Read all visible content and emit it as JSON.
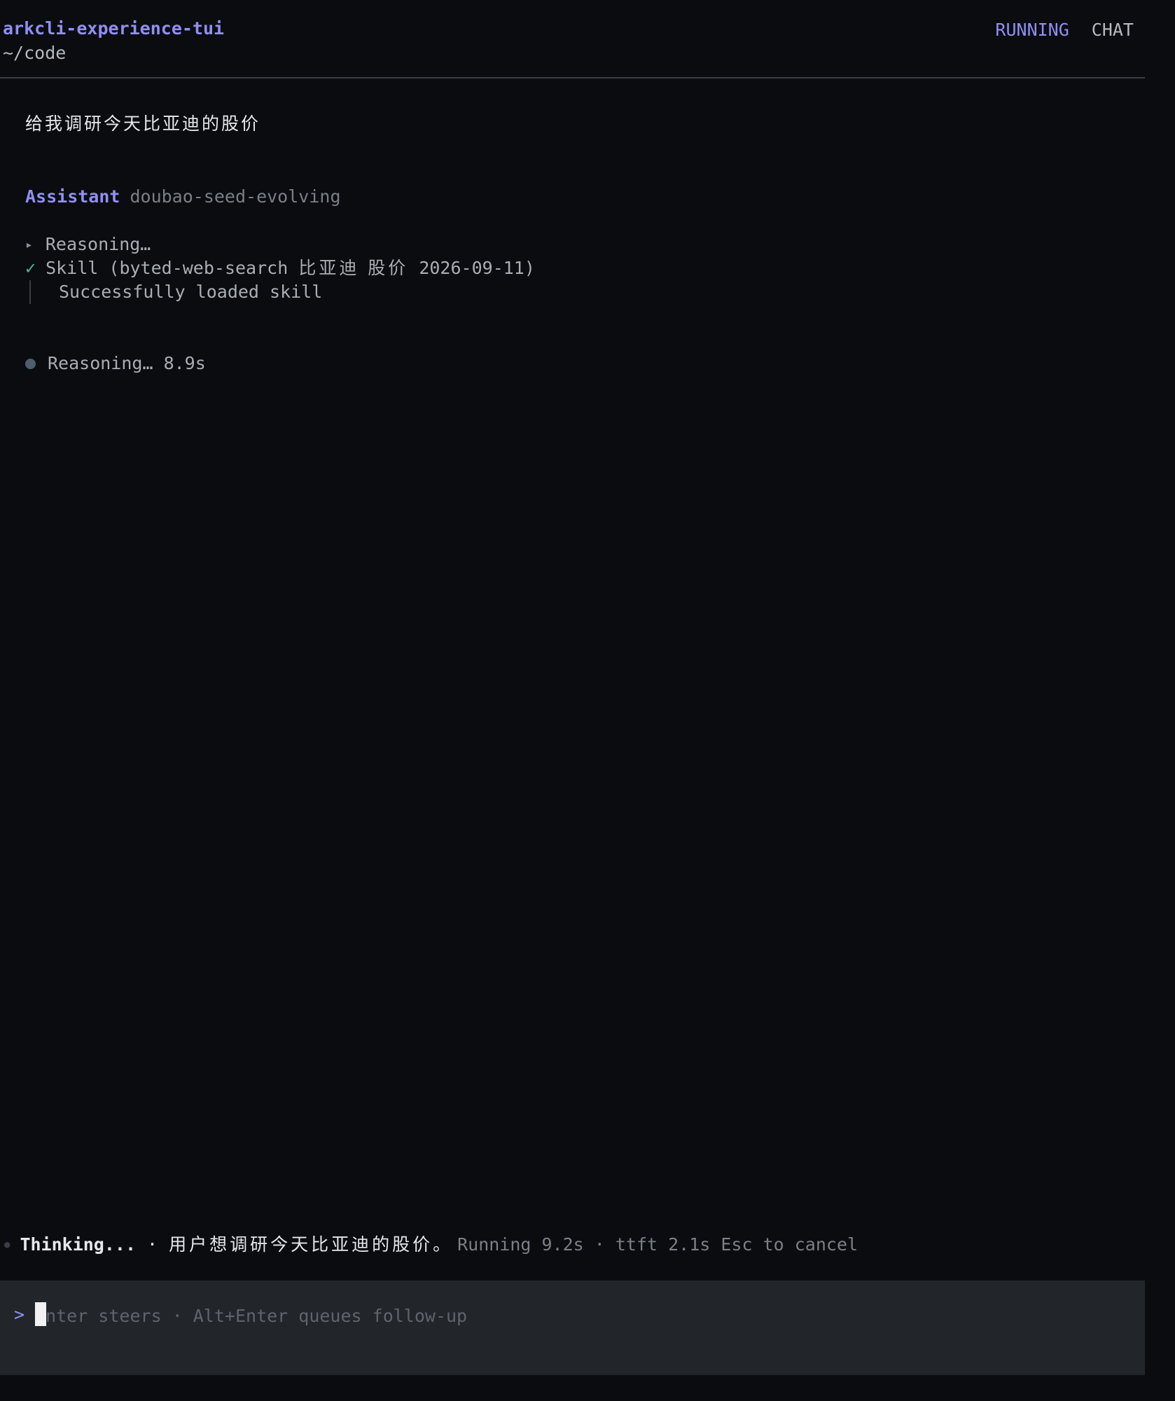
{
  "header": {
    "app_title": "arkcli-experience-tui",
    "cwd": "~/code",
    "status": "RUNNING",
    "mode": "CHAT"
  },
  "conversation": {
    "user_message": "给我调研今天比亚迪的股价",
    "assistant_label": "Assistant",
    "model_name": "doubao-seed-evolving",
    "reasoning_collapsed": "Reasoning…",
    "skill": {
      "name": "Skill",
      "args_prefix": "(byted-web-search ",
      "args_cjk": "比亚迪 股价",
      "args_suffix": " 2026-09-11)",
      "detail": "Successfully loaded skill"
    },
    "reasoning_live": "Reasoning… 8.9s"
  },
  "status_bar": {
    "thinking_label": "Thinking...",
    "separator": "·",
    "thinking_summary": "用户想调研今天比亚迪的股价。",
    "run_meta": "Running 9.2s · ttft 2.1s Esc to cancel"
  },
  "input": {
    "prompt": ">",
    "placeholder": "Enter steers · Alt+Enter queues follow-up",
    "value": ""
  },
  "icons": {
    "caret": "caret-right-icon",
    "check": "check-icon",
    "dot": "spinner-dot-icon"
  },
  "colors": {
    "accent": "#8f8ff5",
    "success": "#48b88a",
    "background": "#0b0c0f",
    "input_panel": "#22262b"
  }
}
